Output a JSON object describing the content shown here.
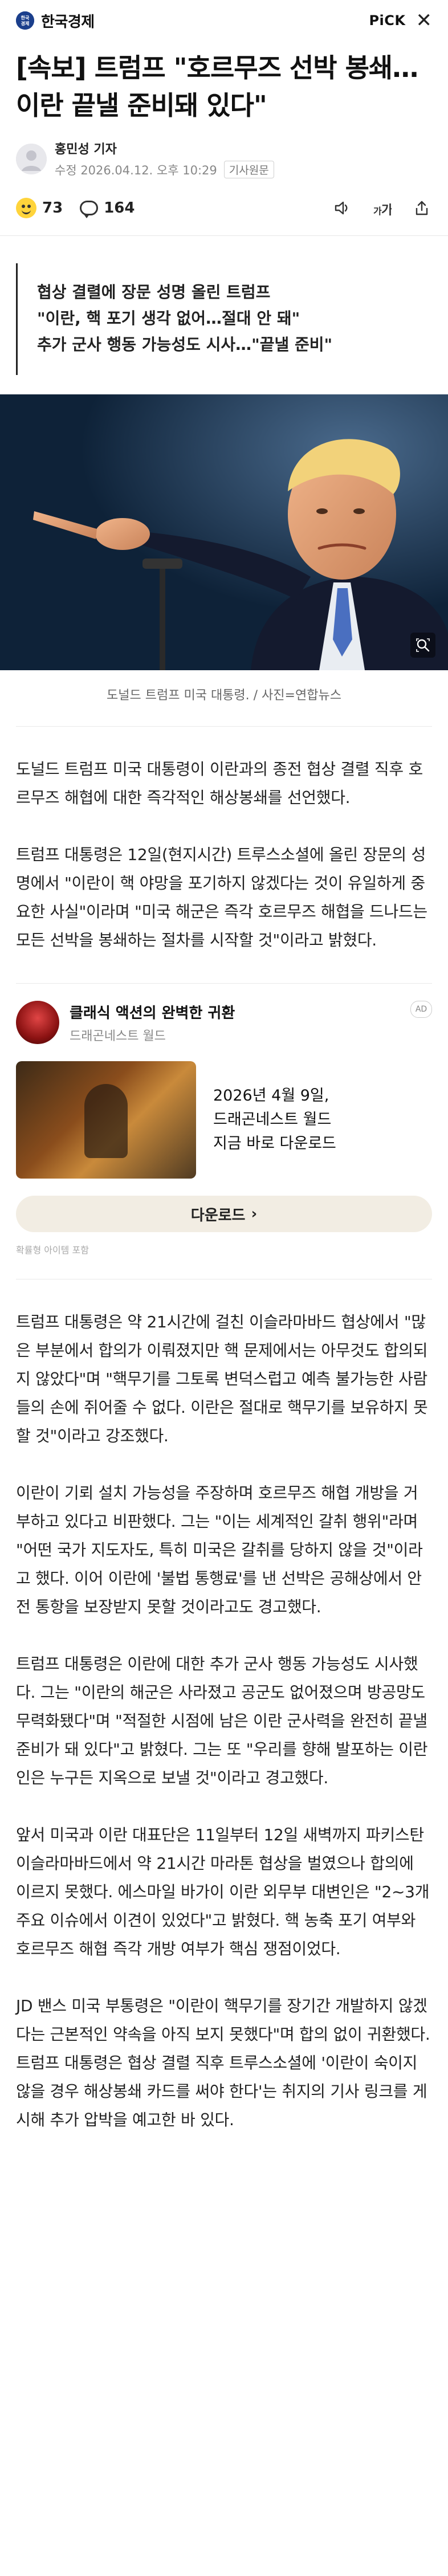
{
  "header": {
    "press_logo_text": "한국\n경제",
    "press_name": "한국경제",
    "pick_label_left": "PiC",
    "pick_label_right": "K"
  },
  "article": {
    "title": "[속보] 트럼프 \"호르무즈 선박 봉쇄…이란 끝낼 준비돼 있다\"",
    "reporter": "홍민성 기자",
    "modified": "수정 2026.04.12. 오후 10:29",
    "original_badge": "기사원문",
    "reaction_count": "73",
    "comment_count": "164",
    "summary": [
      "협상 결렬에 장문 성명 올린 트럼프",
      "\"이란, 핵 포기 생각 없어…절대 안 돼\"",
      "추가 군사 행동 가능성도 시사…\"끝낼 준비\""
    ],
    "caption": "도널드 트럼프 미국 대통령. / 사진=연합뉴스",
    "paragraphs_before_ad": [
      "도널드 트럼프 미국 대통령이 이란과의 종전 협상 결렬 직후 호르무즈 해협에 대한 즉각적인 해상봉쇄를 선언했다.",
      "트럼프 대통령은 12일(현지시간) 트루스소셜에 올린 장문의 성명에서 \"이란이 핵 야망을 포기하지 않겠다는 것이 유일하게 중요한 사실\"이라며 \"미국 해군은 즉각 호르무즈 해협을 드나드는 모든 선박을 봉쇄하는 절차를 시작할 것\"이라고 밝혔다."
    ],
    "paragraphs_after_ad": [
      "트럼프 대통령은 약 21시간에 걸친 이슬라마바드 협상에서 \"많은 부분에서 합의가 이뤄졌지만 핵 문제에서는 아무것도 합의되지 않았다\"며 \"핵무기를 그토록 변덕스럽고 예측 불가능한 사람들의 손에 쥐어줄 수 없다. 이란은 절대로 핵무기를 보유하지 못할 것\"이라고 강조했다.",
      "이란이 기뢰 설치 가능성을 주장하며 호르무즈 해협 개방을 거부하고 있다고 비판했다. 그는 \"이는 세계적인 갈취 행위\"라며 \"어떤 국가 지도자도, 특히 미국은 갈취를 당하지 않을 것\"이라고 했다. 이어 이란에 '불법 통행료'를 낸 선박은 공해상에서 안전 통항을 보장받지 못할 것이라고도 경고했다.",
      "트럼프 대통령은 이란에 대한 추가 군사 행동 가능성도 시사했다. 그는 \"이란의 해군은 사라졌고 공군도 없어졌으며 방공망도 무력화됐다\"며 \"적절한 시점에 남은 이란 군사력을 완전히 끝낼 준비가 돼 있다\"고 밝혔다. 그는 또 \"우리를 향해 발포하는 이란인은 누구든 지옥으로 보낼 것\"이라고 경고했다.",
      "앞서 미국과 이란 대표단은 11일부터 12일 새벽까지 파키스탄 이슬라마바드에서 약 21시간 마라톤 협상을 벌였으나 합의에 이르지 못했다. 에스마일 바가이 이란 외무부 대변인은 \"2~3개 주요 이슈에서 이견이 있었다\"고 밝혔다. 핵 농축 포기 여부와 호르무즈 해협 즉각 개방 여부가 핵심 쟁점이었다.",
      "JD 밴스 미국 부통령은 \"이란이 핵무기를 장기간 개발하지 않겠다는 근본적인 약속을 아직 보지 못했다\"며 합의 없이 귀환했다. 트럼프 대통령은 협상 결렬 직후 트루스소셜에 '이란이 숙이지 않을 경우 해상봉쇄 카드를 써야 한다'는 취지의 기사 링크를 게시해 추가 압박을 예고한 바 있다."
    ]
  },
  "ad": {
    "badge": "AD",
    "title": "클래식 액션의 완벽한 귀환",
    "advertiser": "드래곤네스트 월드",
    "copy_line1": "2026년 4월 9일,",
    "copy_line2": "드래곤네스트 월드",
    "copy_line3": "지금 바로 다운로드",
    "cta": "다운로드",
    "cta_arrow": "›",
    "footnote": "확률형 아이템 포함"
  },
  "colors": {
    "press_logo": "#1b3f8c",
    "text": "#222222",
    "muted": "#888888",
    "ad_cta_bg": "#f2ede3"
  },
  "icons": [
    "press-logo-icon",
    "pick-icon",
    "close-icon",
    "avatar-icon",
    "reaction-emoji-icon",
    "comment-bubble-icon",
    "audio-icon",
    "font-size-icon",
    "share-icon",
    "zoom-icon"
  ]
}
